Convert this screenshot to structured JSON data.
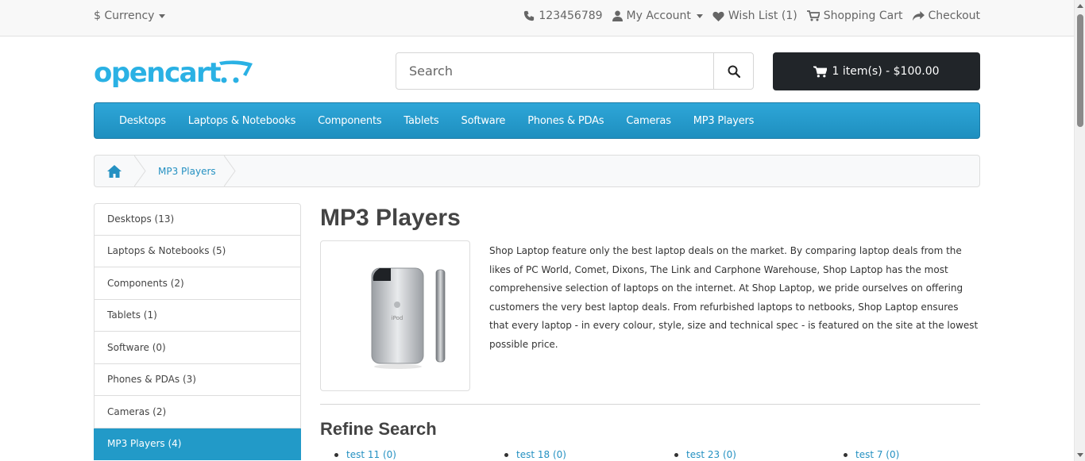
{
  "topbar": {
    "currency": "$ Currency",
    "phone": "123456789",
    "account": "My Account",
    "wishlist": "Wish List (1)",
    "cart": "Shopping Cart",
    "checkout": "Checkout"
  },
  "header": {
    "logo_text": "opencart",
    "search_placeholder": "Search",
    "cart_button": "1 item(s) - $100.00"
  },
  "menu": [
    "Desktops",
    "Laptops & Notebooks",
    "Components",
    "Tablets",
    "Software",
    "Phones & PDAs",
    "Cameras",
    "MP3 Players"
  ],
  "breadcrumb": {
    "current": "MP3 Players"
  },
  "sidebar": [
    "Desktops (13)",
    "Laptops & Notebooks (5)",
    "Components (2)",
    "Tablets (1)",
    "Software (0)",
    "Phones & PDAs (3)",
    "Cameras (2)",
    "MP3 Players (4)"
  ],
  "main": {
    "title": "MP3 Players",
    "description": "Shop Laptop feature only the best laptop deals on the market. By comparing laptop deals from the likes of PC World, Comet, Dixons, The Link and Carphone Warehouse, Shop Laptop has the most comprehensive selection of laptops on the internet. At Shop Laptop, we pride ourselves on offering customers the very best laptop deals. From refurbished laptops to netbooks, Shop Laptop ensures that every laptop - in every colour, style, size and technical spec - is featured on the site at the lowest possible price.",
    "image_label": "iPod",
    "refine_title": "Refine Search",
    "refine": [
      "test 11 (0)",
      "test 18 (0)",
      "test 23 (0)",
      "test 7 (0)"
    ]
  },
  "colors": {
    "accent": "#229ac8",
    "link": "#2591c2",
    "cart_bg": "#212529",
    "logo": "#2ab1e4"
  }
}
